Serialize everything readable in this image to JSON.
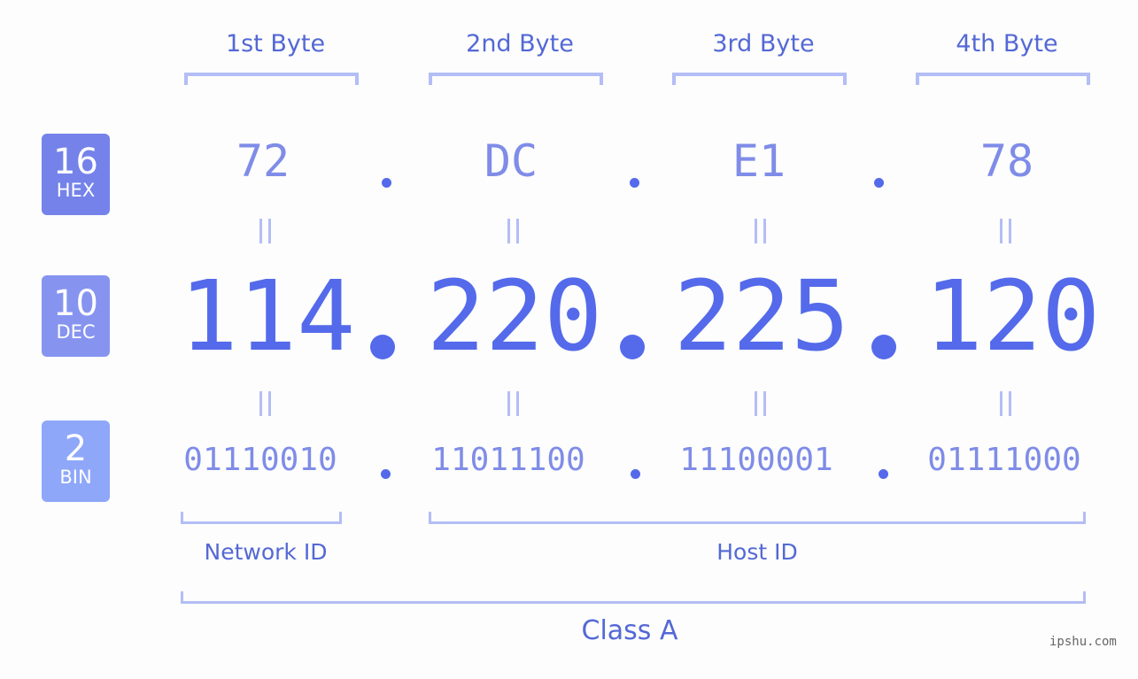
{
  "byte_headers": [
    "1st Byte",
    "2nd Byte",
    "3rd Byte",
    "4th Byte"
  ],
  "badges": [
    {
      "num": "16",
      "name": "HEX",
      "color": "#7482ea"
    },
    {
      "num": "10",
      "name": "DEC",
      "color": "#8694f0"
    },
    {
      "num": "2",
      "name": "BIN",
      "color": "#8ea7f9"
    }
  ],
  "hex": [
    "72",
    "DC",
    "E1",
    "78"
  ],
  "dec": [
    "114",
    "220",
    "225",
    "120"
  ],
  "bin": [
    "01110010",
    "11011100",
    "11100001",
    "01111000"
  ],
  "network_id_label": "Network ID",
  "host_id_label": "Host ID",
  "class_label": "Class A",
  "watermark": "ipshu.com",
  "colors": {
    "primary": "#546aeb",
    "light": "#7f8ce8",
    "bracket": "#b3bdf6"
  }
}
